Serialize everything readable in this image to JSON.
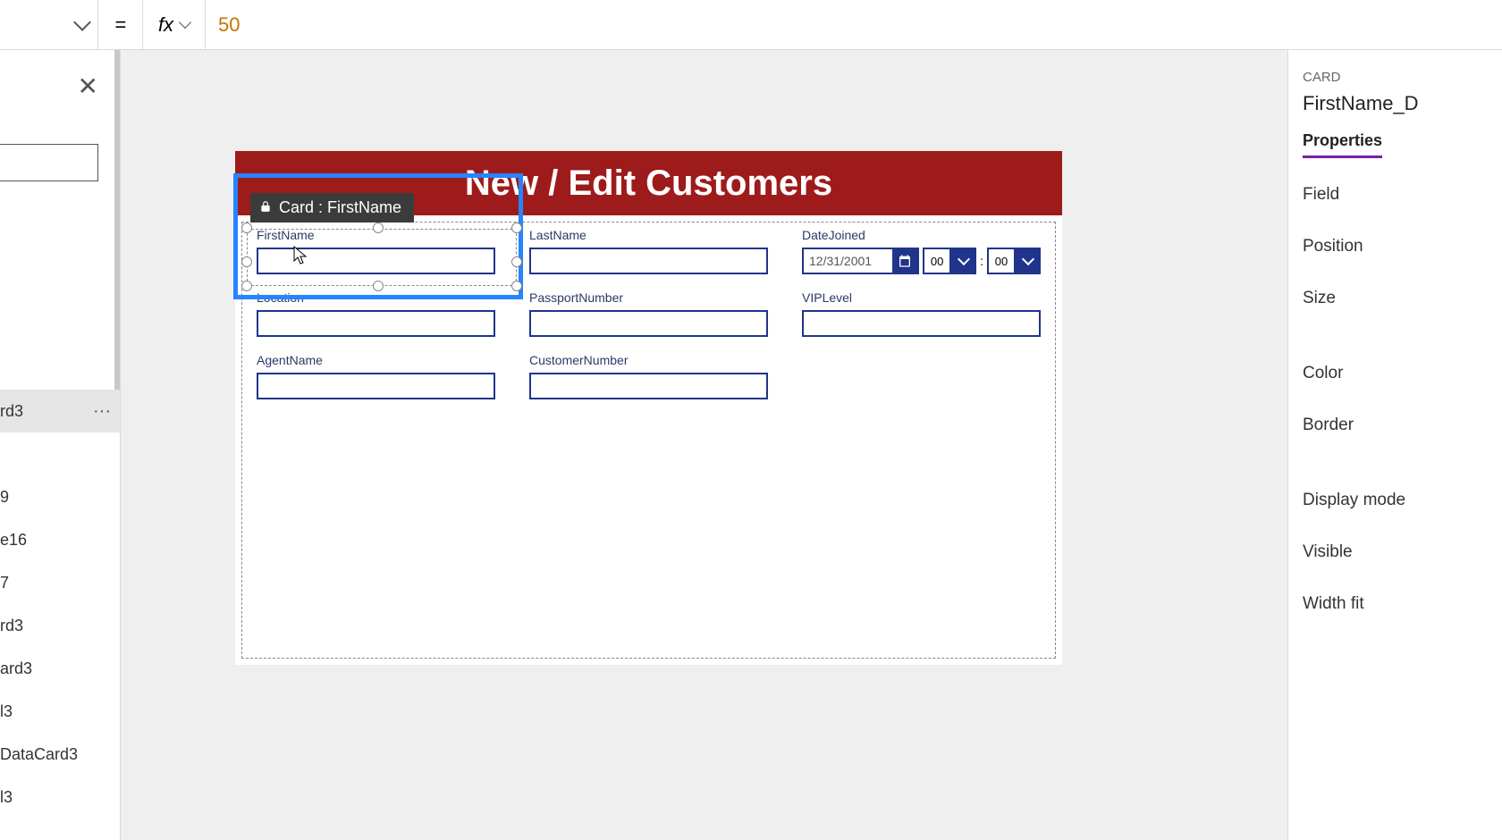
{
  "formula_bar": {
    "equals": "=",
    "fx": "fx",
    "value": "50"
  },
  "tree": {
    "items": [
      {
        "label": "rd3",
        "selected": true
      },
      {
        "label": ""
      },
      {
        "label": "9"
      },
      {
        "label": "e16"
      },
      {
        "label": "7"
      },
      {
        "label": "rd3"
      },
      {
        "label": "ard3"
      },
      {
        "label": "l3"
      },
      {
        "label": "DataCard3"
      },
      {
        "label": "l3"
      }
    ]
  },
  "canvas": {
    "title": "New / Edit Customers",
    "selection_tag": "Card : FirstName",
    "cards": {
      "firstname": {
        "label": "FirstName"
      },
      "lastname": {
        "label": "LastName"
      },
      "datejoined": {
        "label": "DateJoined",
        "date": "12/31/2001",
        "hh": "00",
        "mm": "00",
        "sep": ":"
      },
      "location": {
        "label": "Location"
      },
      "passport": {
        "label": "PassportNumber"
      },
      "vip": {
        "label": "VIPLevel"
      },
      "agent": {
        "label": "AgentName"
      },
      "custno": {
        "label": "CustomerNumber"
      }
    }
  },
  "right_pane": {
    "kind": "CARD",
    "name": "FirstName_D",
    "tab": "Properties",
    "items": [
      "Field",
      "Position",
      "Size",
      "Color",
      "Border",
      "Display mode",
      "Visible",
      "Width fit"
    ]
  }
}
